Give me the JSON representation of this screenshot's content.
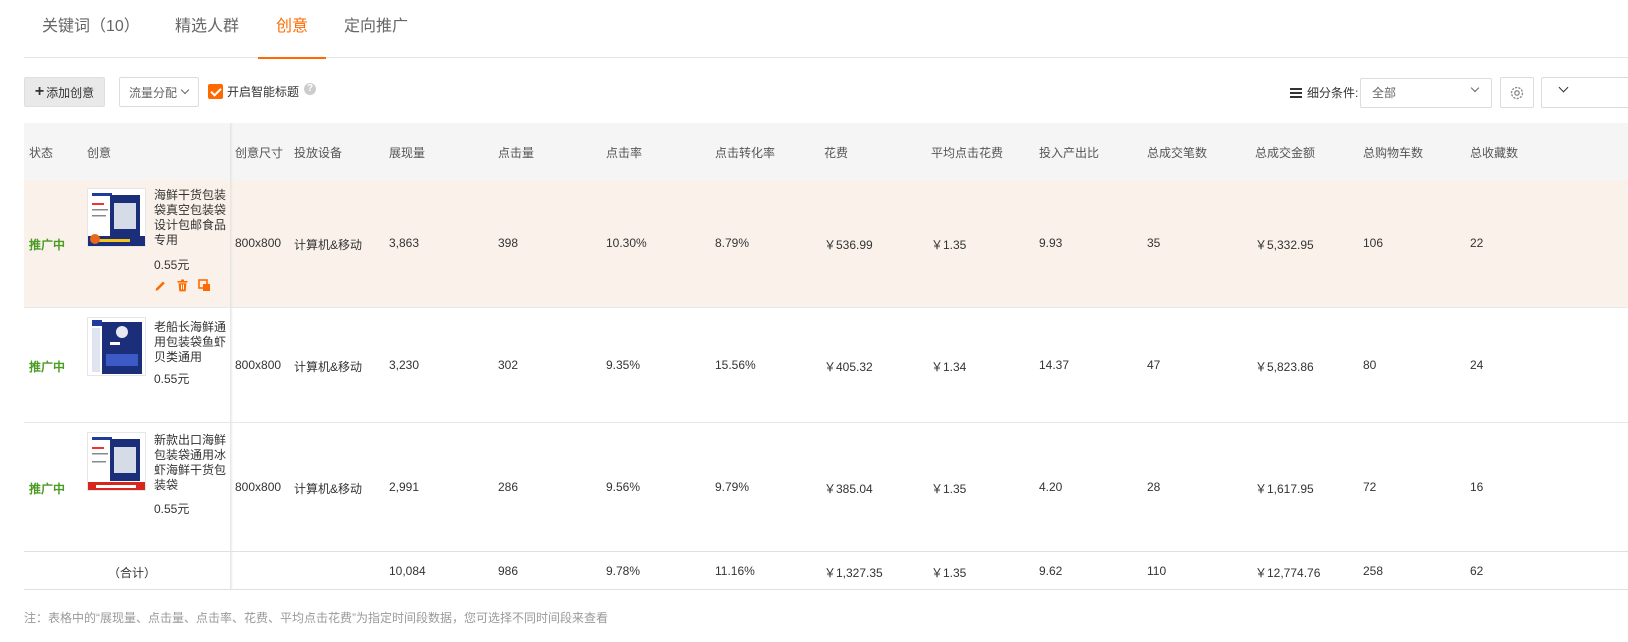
{
  "tabs": [
    {
      "label": "关键词（10）"
    },
    {
      "label": "精选人群"
    },
    {
      "label": "创意"
    },
    {
      "label": "定向推广"
    }
  ],
  "active_tab": "创意",
  "toolbar": {
    "add_label": "添加创意",
    "flow_label": "流量分配",
    "smart_title_label": "开启智能标题",
    "segment_label": "细分条件:",
    "segment_value": "全部"
  },
  "colors": {
    "accent": "#ff6a00",
    "status_active": "#4a9b22",
    "row_highlight": "#faf2ea"
  },
  "table": {
    "headers": [
      "状态",
      "创意",
      "创意尺寸",
      "投放设备",
      "展现量",
      "点击量",
      "点击率",
      "点击转化率",
      "花费",
      "平均点击花费",
      "投入产出比",
      "总成交笔数",
      "总成交金额",
      "总购物车数",
      "总收藏数"
    ],
    "rows": [
      {
        "status": "推广中",
        "title": "海鲜干货包装袋真空包装袋设计包邮食品专用",
        "price": "0.55元",
        "size": "800x800",
        "device": "计算机&移动",
        "impressions": "3,863",
        "clicks": "398",
        "ctr": "10.30%",
        "cvr": "8.79%",
        "cost": "￥536.99",
        "cpc": "￥1.35",
        "roi": "9.93",
        "orders": "35",
        "gmv": "￥5,332.95",
        "carts": "106",
        "favs": "22"
      },
      {
        "status": "推广中",
        "title": "老船长海鲜通用包装袋鱼虾贝类通用",
        "price": "0.55元",
        "size": "800x800",
        "device": "计算机&移动",
        "impressions": "3,230",
        "clicks": "302",
        "ctr": "9.35%",
        "cvr": "15.56%",
        "cost": "￥405.32",
        "cpc": "￥1.34",
        "roi": "14.37",
        "orders": "47",
        "gmv": "￥5,823.86",
        "carts": "80",
        "favs": "24"
      },
      {
        "status": "推广中",
        "title": "新款出口海鲜包装袋通用冰虾海鲜干货包装袋",
        "price": "0.55元",
        "size": "800x800",
        "device": "计算机&移动",
        "impressions": "2,991",
        "clicks": "286",
        "ctr": "9.56%",
        "cvr": "9.79%",
        "cost": "￥385.04",
        "cpc": "￥1.35",
        "roi": "4.20",
        "orders": "28",
        "gmv": "￥1,617.95",
        "carts": "72",
        "favs": "16"
      }
    ],
    "total": {
      "label": "（合计）",
      "impressions": "10,084",
      "clicks": "986",
      "ctr": "9.78%",
      "cvr": "11.16%",
      "cost": "￥1,327.35",
      "cpc": "￥1.35",
      "roi": "9.62",
      "orders": "110",
      "gmv": "￥12,774.76",
      "carts": "258",
      "favs": "62"
    }
  },
  "row_actions": [
    "edit-icon",
    "trash-icon",
    "copy-icon"
  ],
  "footnote": "注：表格中的“展现量、点击量、点击率、花费、平均点击花费”为指定时间段数据，您可选择不同时间段来查看"
}
